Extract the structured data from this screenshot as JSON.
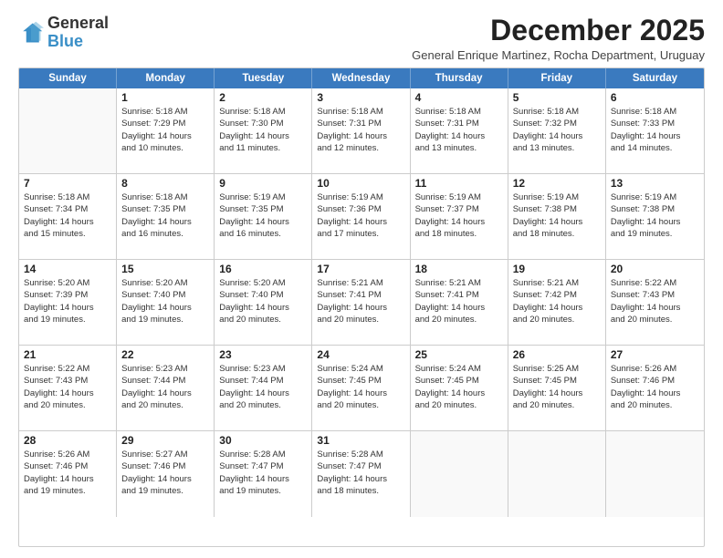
{
  "logo": {
    "general": "General",
    "blue": "Blue"
  },
  "header": {
    "month": "December 2025",
    "subtitle": "General Enrique Martinez, Rocha Department, Uruguay"
  },
  "weekdays": [
    "Sunday",
    "Monday",
    "Tuesday",
    "Wednesday",
    "Thursday",
    "Friday",
    "Saturday"
  ],
  "weeks": [
    [
      {
        "day": "",
        "info": ""
      },
      {
        "day": "1",
        "info": "Sunrise: 5:18 AM\nSunset: 7:29 PM\nDaylight: 14 hours\nand 10 minutes."
      },
      {
        "day": "2",
        "info": "Sunrise: 5:18 AM\nSunset: 7:30 PM\nDaylight: 14 hours\nand 11 minutes."
      },
      {
        "day": "3",
        "info": "Sunrise: 5:18 AM\nSunset: 7:31 PM\nDaylight: 14 hours\nand 12 minutes."
      },
      {
        "day": "4",
        "info": "Sunrise: 5:18 AM\nSunset: 7:31 PM\nDaylight: 14 hours\nand 13 minutes."
      },
      {
        "day": "5",
        "info": "Sunrise: 5:18 AM\nSunset: 7:32 PM\nDaylight: 14 hours\nand 13 minutes."
      },
      {
        "day": "6",
        "info": "Sunrise: 5:18 AM\nSunset: 7:33 PM\nDaylight: 14 hours\nand 14 minutes."
      }
    ],
    [
      {
        "day": "7",
        "info": "Sunrise: 5:18 AM\nSunset: 7:34 PM\nDaylight: 14 hours\nand 15 minutes."
      },
      {
        "day": "8",
        "info": "Sunrise: 5:18 AM\nSunset: 7:35 PM\nDaylight: 14 hours\nand 16 minutes."
      },
      {
        "day": "9",
        "info": "Sunrise: 5:19 AM\nSunset: 7:35 PM\nDaylight: 14 hours\nand 16 minutes."
      },
      {
        "day": "10",
        "info": "Sunrise: 5:19 AM\nSunset: 7:36 PM\nDaylight: 14 hours\nand 17 minutes."
      },
      {
        "day": "11",
        "info": "Sunrise: 5:19 AM\nSunset: 7:37 PM\nDaylight: 14 hours\nand 18 minutes."
      },
      {
        "day": "12",
        "info": "Sunrise: 5:19 AM\nSunset: 7:38 PM\nDaylight: 14 hours\nand 18 minutes."
      },
      {
        "day": "13",
        "info": "Sunrise: 5:19 AM\nSunset: 7:38 PM\nDaylight: 14 hours\nand 19 minutes."
      }
    ],
    [
      {
        "day": "14",
        "info": "Sunrise: 5:20 AM\nSunset: 7:39 PM\nDaylight: 14 hours\nand 19 minutes."
      },
      {
        "day": "15",
        "info": "Sunrise: 5:20 AM\nSunset: 7:40 PM\nDaylight: 14 hours\nand 19 minutes."
      },
      {
        "day": "16",
        "info": "Sunrise: 5:20 AM\nSunset: 7:40 PM\nDaylight: 14 hours\nand 20 minutes."
      },
      {
        "day": "17",
        "info": "Sunrise: 5:21 AM\nSunset: 7:41 PM\nDaylight: 14 hours\nand 20 minutes."
      },
      {
        "day": "18",
        "info": "Sunrise: 5:21 AM\nSunset: 7:41 PM\nDaylight: 14 hours\nand 20 minutes."
      },
      {
        "day": "19",
        "info": "Sunrise: 5:21 AM\nSunset: 7:42 PM\nDaylight: 14 hours\nand 20 minutes."
      },
      {
        "day": "20",
        "info": "Sunrise: 5:22 AM\nSunset: 7:43 PM\nDaylight: 14 hours\nand 20 minutes."
      }
    ],
    [
      {
        "day": "21",
        "info": "Sunrise: 5:22 AM\nSunset: 7:43 PM\nDaylight: 14 hours\nand 20 minutes."
      },
      {
        "day": "22",
        "info": "Sunrise: 5:23 AM\nSunset: 7:44 PM\nDaylight: 14 hours\nand 20 minutes."
      },
      {
        "day": "23",
        "info": "Sunrise: 5:23 AM\nSunset: 7:44 PM\nDaylight: 14 hours\nand 20 minutes."
      },
      {
        "day": "24",
        "info": "Sunrise: 5:24 AM\nSunset: 7:45 PM\nDaylight: 14 hours\nand 20 minutes."
      },
      {
        "day": "25",
        "info": "Sunrise: 5:24 AM\nSunset: 7:45 PM\nDaylight: 14 hours\nand 20 minutes."
      },
      {
        "day": "26",
        "info": "Sunrise: 5:25 AM\nSunset: 7:45 PM\nDaylight: 14 hours\nand 20 minutes."
      },
      {
        "day": "27",
        "info": "Sunrise: 5:26 AM\nSunset: 7:46 PM\nDaylight: 14 hours\nand 20 minutes."
      }
    ],
    [
      {
        "day": "28",
        "info": "Sunrise: 5:26 AM\nSunset: 7:46 PM\nDaylight: 14 hours\nand 19 minutes."
      },
      {
        "day": "29",
        "info": "Sunrise: 5:27 AM\nSunset: 7:46 PM\nDaylight: 14 hours\nand 19 minutes."
      },
      {
        "day": "30",
        "info": "Sunrise: 5:28 AM\nSunset: 7:47 PM\nDaylight: 14 hours\nand 19 minutes."
      },
      {
        "day": "31",
        "info": "Sunrise: 5:28 AM\nSunset: 7:47 PM\nDaylight: 14 hours\nand 18 minutes."
      },
      {
        "day": "",
        "info": ""
      },
      {
        "day": "",
        "info": ""
      },
      {
        "day": "",
        "info": ""
      }
    ]
  ]
}
